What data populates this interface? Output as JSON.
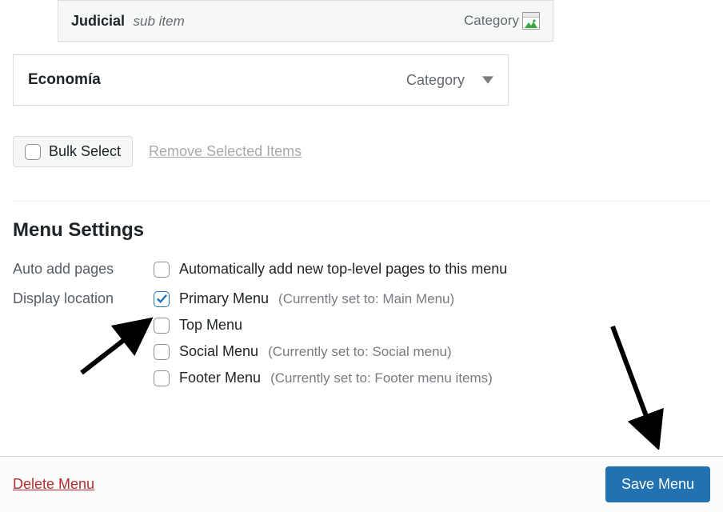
{
  "sub_item": {
    "title": "Judicial",
    "meta": "sub item",
    "category_label": "Category"
  },
  "main_item": {
    "title": "Economía",
    "category_label": "Category"
  },
  "bulk": {
    "select_label": "Bulk Select",
    "remove_label": "Remove Selected Items"
  },
  "section_title": "Menu Settings",
  "settings": {
    "auto_add_label": "Auto add pages",
    "auto_add_option": "Automatically add new top-level pages to this menu",
    "display_location_label": "Display location",
    "locations": [
      {
        "label": "Primary Menu",
        "paren": "(Currently set to: Main Menu)",
        "checked": true
      },
      {
        "label": "Top Menu",
        "paren": "",
        "checked": false
      },
      {
        "label": "Social Menu",
        "paren": "(Currently set to: Social menu)",
        "checked": false
      },
      {
        "label": "Footer Menu",
        "paren": "(Currently set to: Footer menu items)",
        "checked": false
      }
    ]
  },
  "footer": {
    "delete_label": "Delete Menu",
    "save_label": "Save Menu"
  }
}
